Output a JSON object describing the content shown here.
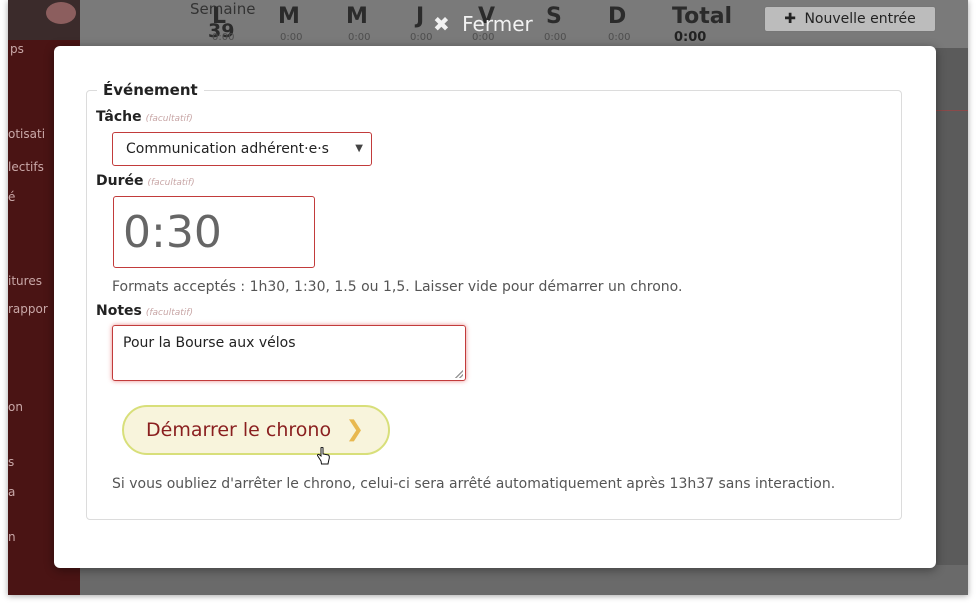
{
  "background": {
    "sidebar_fragments": [
      "ps",
      "otisati",
      "lectifs",
      "é",
      "itures",
      "rappor",
      "on",
      "s",
      "a",
      "n"
    ],
    "week": {
      "label": "Semaine",
      "number": "39"
    },
    "days": [
      {
        "letter": "L",
        "value": "0:00"
      },
      {
        "letter": "M",
        "value": "0:00"
      },
      {
        "letter": "M",
        "value": "0:00"
      },
      {
        "letter": "J",
        "value": "0:00"
      },
      {
        "letter": "V",
        "value": "0:00"
      },
      {
        "letter": "S",
        "value": "0:00"
      },
      {
        "letter": "D",
        "value": "0:00"
      }
    ],
    "total": {
      "label": "Total",
      "value": "0:00"
    },
    "new_entry_label": "Nouvelle entrée"
  },
  "close_label": "Fermer",
  "icons": {
    "close": "close-icon",
    "plus": "plus-icon",
    "arrow": "chevron-right-icon",
    "cursor": "hand-cursor-icon"
  },
  "form": {
    "legend": "Événement",
    "optional_tag": "(facultatif)",
    "task": {
      "label": "Tâche",
      "selected": "Communication adhérent·e·s"
    },
    "duration": {
      "label": "Durée",
      "value": "0:30",
      "help": "Formats acceptés : 1h30, 1:30, 1.5 ou 1,5. Laisser vide pour démarrer un chrono."
    },
    "notes": {
      "label": "Notes",
      "value": "Pour la Bourse aux vélos"
    },
    "start_button": "Démarrer le chrono",
    "auto_stop_note": "Si vous oubliez d'arrêter le chrono, celui-ci sera arrêté automatiquement après 13h37 sans interaction."
  },
  "colors": {
    "accent": "#8a1f1f",
    "error_border": "#c23b3b",
    "button_bg": "#f8f4dc",
    "button_border": "#d8df7a",
    "arrow": "#e8b850"
  }
}
